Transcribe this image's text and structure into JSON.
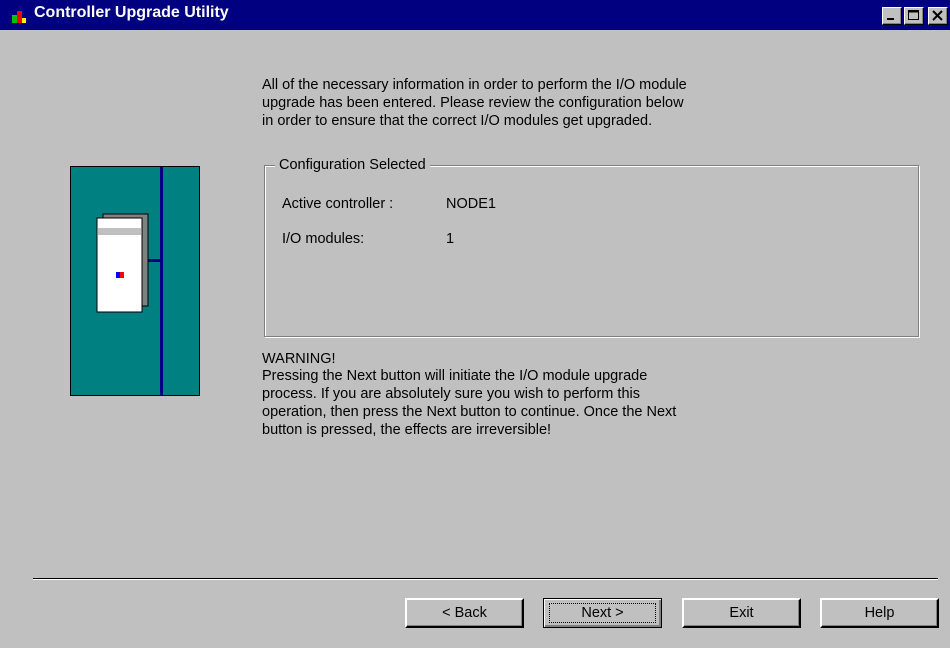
{
  "window": {
    "title": "Controller Upgrade Utility",
    "title_bar_color": "#000080",
    "controls": [
      "minimize-icon",
      "maximize-icon",
      "close-icon"
    ]
  },
  "intro": {
    "text": "All of the necessary information in order to perform the I/O module\nupgrade has been entered. Please review the configuration below\nin order to ensure that the correct I/O modules get upgraded."
  },
  "config": {
    "legend": "Configuration Selected",
    "rows": [
      {
        "label": "Active controller :",
        "value": "NODE1"
      },
      {
        "label": "I/O modules:",
        "value": "1"
      }
    ]
  },
  "warning": {
    "title": "WARNING!",
    "text": "Pressing the Next button will initiate the I/O module upgrade\nprocess. If you are absolutely sure you wish to perform this\noperation, then press the Next button to continue. Once the Next\nbutton is pressed, the effects are irreversible!"
  },
  "buttons": {
    "back": "< Back",
    "next": "Next >",
    "exit": "Exit",
    "help": "Help"
  },
  "illustration": {
    "icon": "controller-cabinet-icon",
    "cabinet_color": "#008080",
    "bus_color": "#000080"
  }
}
